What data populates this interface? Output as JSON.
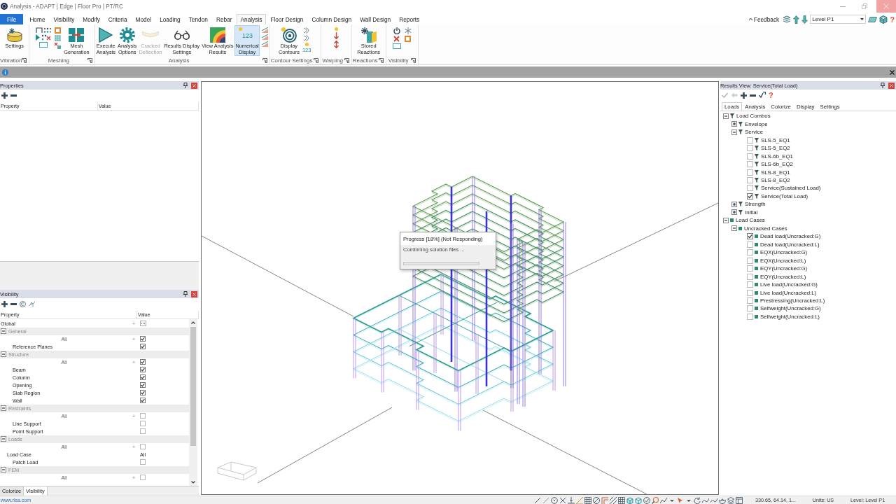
{
  "window": {
    "title": "Analysis - ADAPT | Edge | Floor Pro | PT/RC"
  },
  "menu_tabs": [
    {
      "label": "File",
      "kind": "file",
      "selected": false
    },
    {
      "label": "Home",
      "kind": "tab",
      "selected": false
    },
    {
      "label": "Visibility",
      "kind": "tab",
      "selected": false
    },
    {
      "label": "Modify",
      "kind": "tab",
      "selected": false
    },
    {
      "label": "Criteria",
      "kind": "tab",
      "selected": false
    },
    {
      "label": "Model",
      "kind": "tab",
      "selected": false
    },
    {
      "label": "Loading",
      "kind": "tab",
      "selected": false
    },
    {
      "label": "Tendon",
      "kind": "tab",
      "selected": false
    },
    {
      "label": "Rebar",
      "kind": "tab",
      "selected": false
    },
    {
      "label": "Analysis",
      "kind": "tab",
      "selected": true
    },
    {
      "label": "Floor Design",
      "kind": "tab",
      "selected": false
    },
    {
      "label": "Column Design",
      "kind": "tab",
      "selected": false
    },
    {
      "label": "Wall Design",
      "kind": "tab",
      "selected": false
    },
    {
      "label": "Reports",
      "kind": "tab",
      "selected": false
    }
  ],
  "quick_access": {
    "feedback": "Feedback",
    "level": "Level P1",
    "help": "?"
  },
  "ribbon": {
    "groups": [
      {
        "label": "Vibration",
        "items": [
          {
            "kind": "large",
            "label": "Settings",
            "on": false,
            "disabled": false
          }
        ]
      },
      {
        "label": "Meshing",
        "items": [
          {
            "kind": "stack"
          },
          {
            "kind": "stack"
          },
          {
            "kind": "large",
            "label": "Mesh\nGeneration",
            "on": false,
            "disabled": false
          }
        ]
      },
      {
        "label": "Analysis",
        "items": [
          {
            "kind": "large",
            "label": "Execute\nAnalysis",
            "on": false,
            "disabled": false
          },
          {
            "kind": "large",
            "label": "Analysis\nOptions",
            "on": false,
            "disabled": false
          },
          {
            "kind": "large",
            "label": "Cracked\nDeflection",
            "on": false,
            "disabled": true
          },
          {
            "kind": "large",
            "label": "Results Display\nSettings",
            "on": false,
            "disabled": false
          },
          {
            "kind": "large",
            "label": "View Analysis\nResults",
            "on": false,
            "disabled": false
          },
          {
            "kind": "large",
            "label": "Numerical\nDisplay",
            "icon_text": "123",
            "on": true,
            "disabled": false
          },
          {
            "kind": "stack"
          }
        ]
      },
      {
        "label": "Contour Settings",
        "items": [
          {
            "kind": "large",
            "label": "Display\nContours",
            "on": false,
            "disabled": false
          },
          {
            "kind": "stack",
            "icon_text": "123"
          }
        ]
      },
      {
        "label": "Warping",
        "items": [
          {
            "kind": "stack"
          }
        ]
      },
      {
        "label": "Reactions",
        "items": [
          {
            "kind": "large",
            "label": "Stored\nReactions",
            "on": false,
            "disabled": false
          }
        ]
      },
      {
        "label": "Visibility",
        "items": [
          {
            "kind": "stack"
          },
          {
            "kind": "stack"
          }
        ]
      }
    ]
  },
  "properties_panel": {
    "title": "Properties",
    "columns": [
      "Property",
      "Value"
    ]
  },
  "visibility_panel": {
    "title": "Visibility",
    "columns": [
      "Property",
      "Value"
    ],
    "global": {
      "label": "Global",
      "plus": "+"
    },
    "categories": [
      {
        "label": "General",
        "expanded": true,
        "children": [
          {
            "kind": "all",
            "label": "All",
            "plus": "+",
            "checked": true
          },
          {
            "kind": "check",
            "label": "Reference Planes",
            "checked": true
          }
        ]
      },
      {
        "label": "Structure",
        "expanded": true,
        "children": [
          {
            "kind": "all",
            "label": "All",
            "plus": "+",
            "checked": true
          },
          {
            "kind": "check",
            "label": "Beam",
            "checked": true
          },
          {
            "kind": "check",
            "label": "Column",
            "checked": true
          },
          {
            "kind": "check",
            "label": "Opening",
            "checked": true
          },
          {
            "kind": "check",
            "label": "Slab Region",
            "checked": true
          },
          {
            "kind": "check",
            "label": "Wall",
            "checked": true
          }
        ]
      },
      {
        "label": "Restraints",
        "expanded": true,
        "children": [
          {
            "kind": "all",
            "label": "All",
            "plus": "+",
            "checked": false
          },
          {
            "kind": "check",
            "label": "Line Support",
            "checked": false
          },
          {
            "kind": "check",
            "label": "Point Support",
            "checked": false
          }
        ]
      },
      {
        "label": "Loads",
        "expanded": true,
        "children": [
          {
            "kind": "all",
            "label": "All",
            "plus": "+",
            "checked": false
          },
          {
            "kind": "text",
            "label": "Load Case",
            "value": "All"
          },
          {
            "kind": "check",
            "label": "Patch Load",
            "checked": false
          }
        ]
      },
      {
        "label": "FEM",
        "expanded": true,
        "children": [
          {
            "kind": "all",
            "label": "All",
            "plus": "+",
            "checked": false
          }
        ]
      }
    ]
  },
  "left_tabs": [
    {
      "label": "Colorize",
      "selected": false
    },
    {
      "label": "Visibility",
      "selected": true
    }
  ],
  "viewport": {
    "progress_dialog": {
      "title": "Progress [18%] (Not Responding)",
      "message": "Combining solution files ..."
    }
  },
  "results_panel": {
    "title": "Results View: Service(Total Load)",
    "help": "?",
    "tabs": [
      {
        "label": "Loads",
        "selected": true
      },
      {
        "label": "Analysis",
        "selected": false
      },
      {
        "label": "Colorize",
        "selected": false
      },
      {
        "label": "Display",
        "selected": false
      },
      {
        "label": "Settings",
        "selected": false
      }
    ],
    "tree": [
      {
        "label": "Load Combos",
        "kind": "combo",
        "expanded": true,
        "children": [
          {
            "label": "Envelope",
            "kind": "combo",
            "expanded": false
          },
          {
            "label": "Service",
            "kind": "combo",
            "expanded": true,
            "children": [
              {
                "label": "SLS-5_EQ1",
                "kind": "combo",
                "checked": false
              },
              {
                "label": "SLS-5_EQ2",
                "kind": "combo",
                "checked": false
              },
              {
                "label": "SLS-6b_EQ1",
                "kind": "combo",
                "checked": false
              },
              {
                "label": "SLS-6b_EQ2",
                "kind": "combo",
                "checked": false
              },
              {
                "label": "SLS-8_EQ1",
                "kind": "combo",
                "checked": false
              },
              {
                "label": "SLS-8_EQ2",
                "kind": "combo",
                "checked": false
              },
              {
                "label": "Service(Sustained Load)",
                "kind": "combo",
                "checked": false
              },
              {
                "label": "Service(Total Load)",
                "kind": "combo",
                "checked": true
              }
            ]
          },
          {
            "label": "Strength",
            "kind": "combo",
            "expanded": false
          },
          {
            "label": "Initial",
            "kind": "combo",
            "expanded": false
          }
        ]
      },
      {
        "label": "Load Cases",
        "kind": "case",
        "expanded": true,
        "children": [
          {
            "label": "Uncracked Cases",
            "kind": "case",
            "expanded": true,
            "children": [
              {
                "label": "Dead load(Uncracked:G)",
                "kind": "case",
                "checked": true
              },
              {
                "label": "Dead load(Uncracked:L)",
                "kind": "case",
                "checked": false
              },
              {
                "label": "EQX(Uncracked:G)",
                "kind": "case",
                "checked": false
              },
              {
                "label": "EQX(Uncracked:L)",
                "kind": "case",
                "checked": false
              },
              {
                "label": "EQY(Uncracked:G)",
                "kind": "case",
                "checked": false
              },
              {
                "label": "EQY(Uncracked:L)",
                "kind": "case",
                "checked": false
              },
              {
                "label": "Live load(Uncracked:G)",
                "kind": "case",
                "checked": false
              },
              {
                "label": "Live load(Uncracked:L)",
                "kind": "case",
                "checked": false
              },
              {
                "label": "Prestressing(Uncracked:L)",
                "kind": "case",
                "checked": false
              },
              {
                "label": "Selfweight(Uncracked:G)",
                "kind": "case",
                "checked": false
              },
              {
                "label": "Selfweight(Uncracked:L)",
                "kind": "case",
                "checked": false
              }
            ]
          }
        ]
      }
    ]
  },
  "status_bar": {
    "link": "www.risa.com",
    "coordinates": "330.65, 64.14, 1...",
    "units": "Units: US",
    "level": "Level: Level P1"
  }
}
